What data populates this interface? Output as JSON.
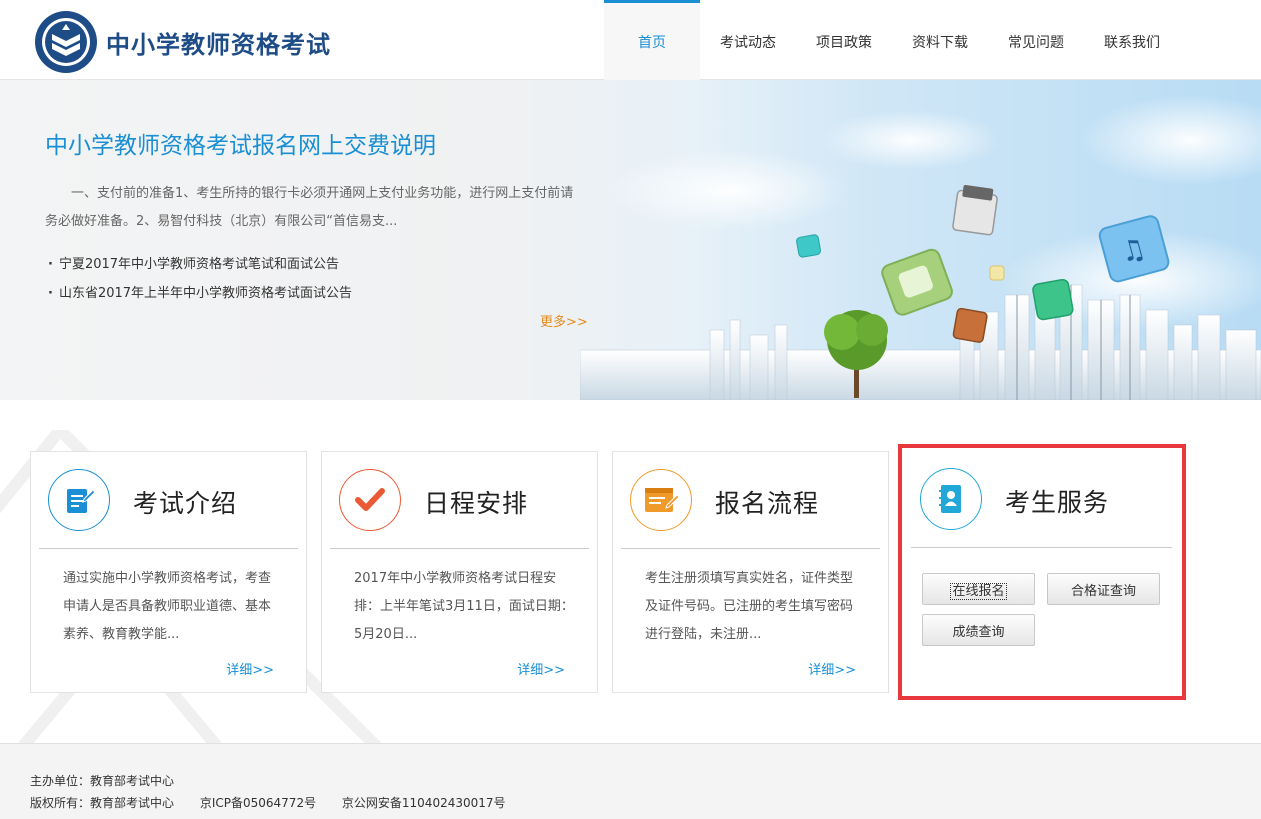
{
  "header": {
    "site_title": "中小学教师资格考试",
    "nav": [
      {
        "label": "首页",
        "active": true
      },
      {
        "label": "考试动态"
      },
      {
        "label": "项目政策"
      },
      {
        "label": "资料下载"
      },
      {
        "label": "常见问题"
      },
      {
        "label": "联系我们"
      }
    ],
    "accent_color": "#1a8fd3"
  },
  "banner": {
    "title": "中小学教师资格考试报名网上交费说明",
    "description": "一、支付前的准备1、考生所持的银行卡必须开通网上支付业务功能，进行网上支付前请务必做好准备。2、易智付科技（北京）有限公司“首信易支...",
    "news": [
      "宁夏2017年中小学教师资格考试笔试和面试公告",
      "山东省2017年上半年中小学教师资格考试面试公告"
    ],
    "more_label": "更多>>"
  },
  "cards": [
    {
      "title": "考试介绍",
      "icon": "document-edit-icon",
      "color": "#1a8fd3",
      "text": "通过实施中小学教师资格考试，考查申请人是否具备教师职业道德、基本素养、教育教学能...",
      "more": "详细>>"
    },
    {
      "title": "日程安排",
      "icon": "checkmark-icon",
      "color": "#ea5a35",
      "text": "2017年中小学教师资格考试日程安排：上半年笔试3月11日，面试日期：5月20日...",
      "more": "详细>>"
    },
    {
      "title": "报名流程",
      "icon": "form-pen-icon",
      "color": "#f09a2c",
      "text": "考生注册须填写真实姓名，证件类型及证件号码。已注册的考生填写密码进行登陆，未注册...",
      "more": "详细>>"
    }
  ],
  "service": {
    "title": "考生服务",
    "icon": "contact-book-icon",
    "buttons": {
      "online_register": "在线报名",
      "certificate_query": "合格证查询",
      "score_query": "成绩查询"
    },
    "highlight_color": "#e8383d"
  },
  "footer": {
    "organizer": "主办单位：教育部考试中心",
    "copyright": "版权所有：教育部考试中心",
    "icp": "京ICP备05064772号",
    "police": "京公网安备110402430017号"
  }
}
